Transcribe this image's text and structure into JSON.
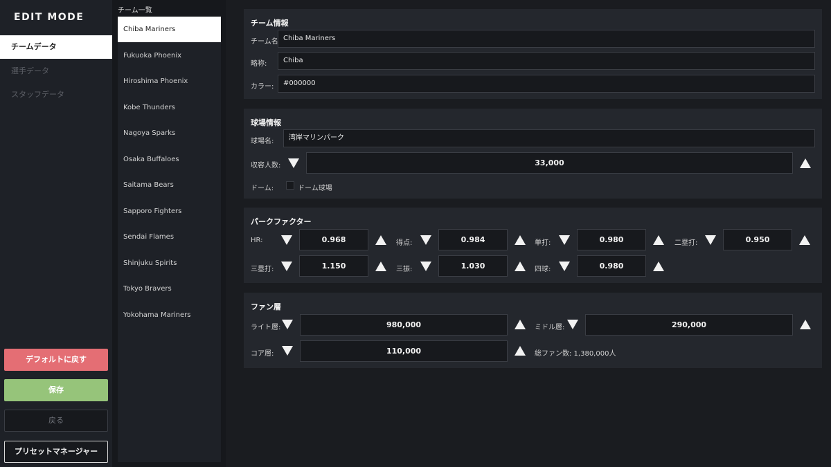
{
  "nav": {
    "title": "EDIT MODE",
    "items": [
      {
        "label": "チームデータ"
      },
      {
        "label": "選手データ"
      },
      {
        "label": "スタッフデータ"
      }
    ],
    "default_button": "デフォルトに戻す",
    "save_button": "保存",
    "back_button": "戻る",
    "preset_button": "プリセットマネージャー"
  },
  "team_list": {
    "title": "チーム一覧",
    "teams": [
      "Chiba Mariners",
      "Fukuoka Phoenix",
      "Hiroshima Phoenix",
      "Kobe Thunders",
      "Nagoya Sparks",
      "Osaka Buffaloes",
      "Saitama Bears",
      "Sapporo Fighters",
      "Sendai Flames",
      "Shinjuku Spirits",
      "Tokyo Bravers",
      "Yokohama Mariners"
    ]
  },
  "team_info": {
    "title": "チーム情報",
    "name_label": "チーム名:",
    "name_value": "Chiba Mariners",
    "abbr_label": "略称:",
    "abbr_value": "Chiba",
    "color_label": "カラー:",
    "color_value": "#000000"
  },
  "stadium": {
    "title": "球場情報",
    "name_label": "球場名:",
    "name_value": "湾岸マリンパーク",
    "capacity_label": "収容人数:",
    "capacity_value": "33,000",
    "dome_label": "ドーム:",
    "dome_checkbox_label": "ドーム球場"
  },
  "park_factor": {
    "title": "パークファクター",
    "hr_label": "HR:",
    "hr_value": "0.968",
    "runs_label": "得点:",
    "runs_value": "0.984",
    "single_label": "単打:",
    "single_value": "0.980",
    "double_label": "二塁打:",
    "double_value": "0.950",
    "triple_label": "三塁打:",
    "triple_value": "1.150",
    "strikeout_label": "三振:",
    "strikeout_value": "1.030",
    "walk_label": "四球:",
    "walk_value": "0.980"
  },
  "fans": {
    "title": "ファン層",
    "light_label": "ライト層:",
    "light_value": "980,000",
    "middle_label": "ミドル層:",
    "middle_value": "290,000",
    "core_label": "コア層:",
    "core_value": "110,000",
    "total_text": "総ファン数: 1,380,000人"
  },
  "icons": {
    "decrement": "triangle-down-icon",
    "increment": "triangle-up-icon",
    "checkbox": "checkbox-unchecked"
  },
  "colors": {
    "accent_default": "#e46e74",
    "accent_save": "#96c47a",
    "panel": "#24272d",
    "field": "#17191d"
  }
}
